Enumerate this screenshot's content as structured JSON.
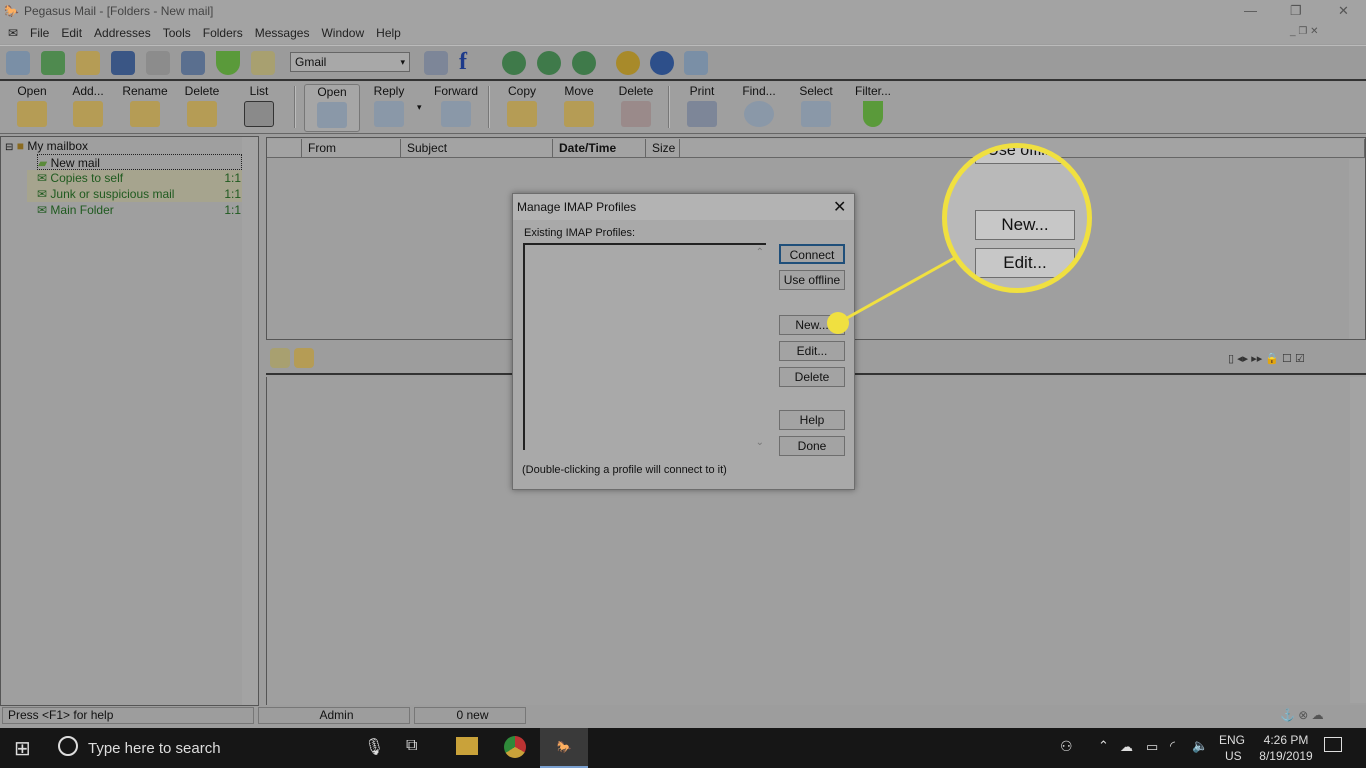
{
  "window": {
    "title": "Pegasus Mail - [Folders - New mail]",
    "minimize": "—",
    "restore": "❐",
    "close": "✕"
  },
  "menu": [
    "File",
    "Edit",
    "Addresses",
    "Tools",
    "Folders",
    "Messages",
    "Window",
    "Help"
  ],
  "toolbar1": {
    "identity": "Gmail",
    "icons": [
      "new-message-icon",
      "inbox-icon",
      "folders-icon",
      "addressbook-icon",
      "notice-board-icon",
      "distribution-list-icon",
      "filter-icon",
      "checklist-icon",
      "print-icon",
      "font-icon",
      "upload-icon",
      "download-icon",
      "sync-icon",
      "coins-icon",
      "phone-info-icon",
      "pegasus-icon"
    ]
  },
  "toolbar2": {
    "folder_buttons": [
      "Open",
      "Add...",
      "Rename",
      "Delete",
      "List"
    ],
    "message_buttons": [
      "Open",
      "Reply",
      "Forward",
      "Copy",
      "Move",
      "Delete",
      "Print",
      "Find...",
      "Select",
      "Filter..."
    ]
  },
  "tree": {
    "root": "My mailbox",
    "items": [
      {
        "name": "New mail",
        "count": ""
      },
      {
        "name": "Copies to self",
        "count": "1:1"
      },
      {
        "name": "Junk or suspicious mail",
        "count": "1:1"
      },
      {
        "name": "Main Folder",
        "count": "1:1"
      }
    ]
  },
  "columns": [
    "From",
    "Subject",
    "Date/Time",
    "Size"
  ],
  "dialog": {
    "title": "Manage IMAP Profiles",
    "list_label": "Existing IMAP Profiles:",
    "buttons": [
      "Connect",
      "Use offline",
      "New...",
      "Edit...",
      "Delete",
      "Help",
      "Done"
    ],
    "hint": "(Double-clicking a profile will connect to it)"
  },
  "magnifier": {
    "top_text": "Use offline",
    "buttons": [
      "New...",
      "Edit..."
    ]
  },
  "status": {
    "help": "Press <F1> for help",
    "user": "Admin",
    "new": "0 new"
  },
  "taskbar": {
    "search_placeholder": "Type here to search",
    "lang1": "ENG",
    "lang2": "US",
    "time": "4:26 PM",
    "date": "8/19/2019"
  },
  "colors": {
    "highlight": "#f0e040",
    "taskbar": "#161616",
    "tree_green": "#1f5a1f"
  }
}
